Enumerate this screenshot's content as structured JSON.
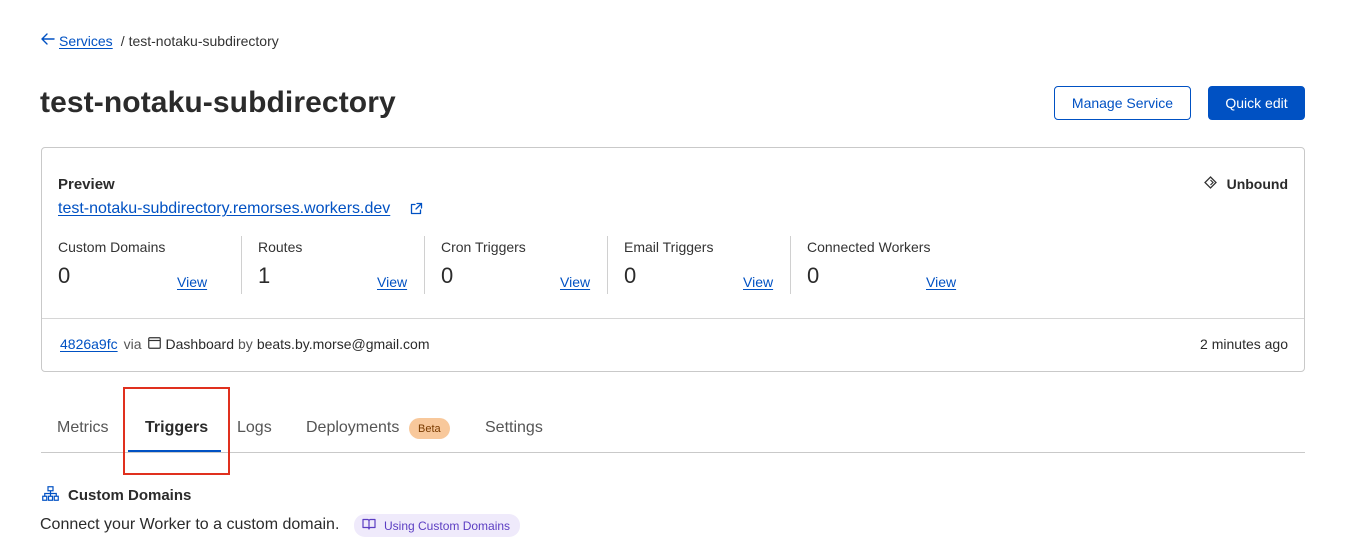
{
  "breadcrumb": {
    "back_label": "Services",
    "separator": "/",
    "current": "test-notaku-subdirectory"
  },
  "header": {
    "title": "test-notaku-subdirectory",
    "manage_button": "Manage Service",
    "quick_edit_button": "Quick edit"
  },
  "preview": {
    "label": "Preview",
    "url": "test-notaku-subdirectory.remorses.workers.dev",
    "status": "Unbound",
    "stats": [
      {
        "label": "Custom Domains",
        "count": "0",
        "view": "View"
      },
      {
        "label": "Routes",
        "count": "1",
        "view": "View"
      },
      {
        "label": "Cron Triggers",
        "count": "0",
        "view": "View"
      },
      {
        "label": "Email Triggers",
        "count": "0",
        "view": "View"
      },
      {
        "label": "Connected Workers",
        "count": "0",
        "view": "View"
      }
    ],
    "deployment": {
      "hash": "4826a9fc",
      "via": "via",
      "source": "Dashboard",
      "by": "by",
      "email": "beats.by.morse@gmail.com",
      "time_ago": "2 minutes ago"
    }
  },
  "tabs": [
    {
      "label": "Metrics"
    },
    {
      "label": "Triggers",
      "active": true
    },
    {
      "label": "Logs"
    },
    {
      "label": "Deployments",
      "badge": "Beta"
    },
    {
      "label": "Settings"
    }
  ],
  "custom_domains": {
    "heading": "Custom Domains",
    "description": "Connect your Worker to a custom domain.",
    "doc_link": "Using Custom Domains"
  },
  "colors": {
    "accent": "#0051c3",
    "highlight": "#e0301e",
    "beta_badge": "#f8c89b",
    "doc_pill": "#efeafb"
  },
  "icons": [
    "arrow-left-icon",
    "external-link-icon",
    "unbound-icon",
    "dashboard-icon",
    "sitemap-icon",
    "book-icon"
  ]
}
